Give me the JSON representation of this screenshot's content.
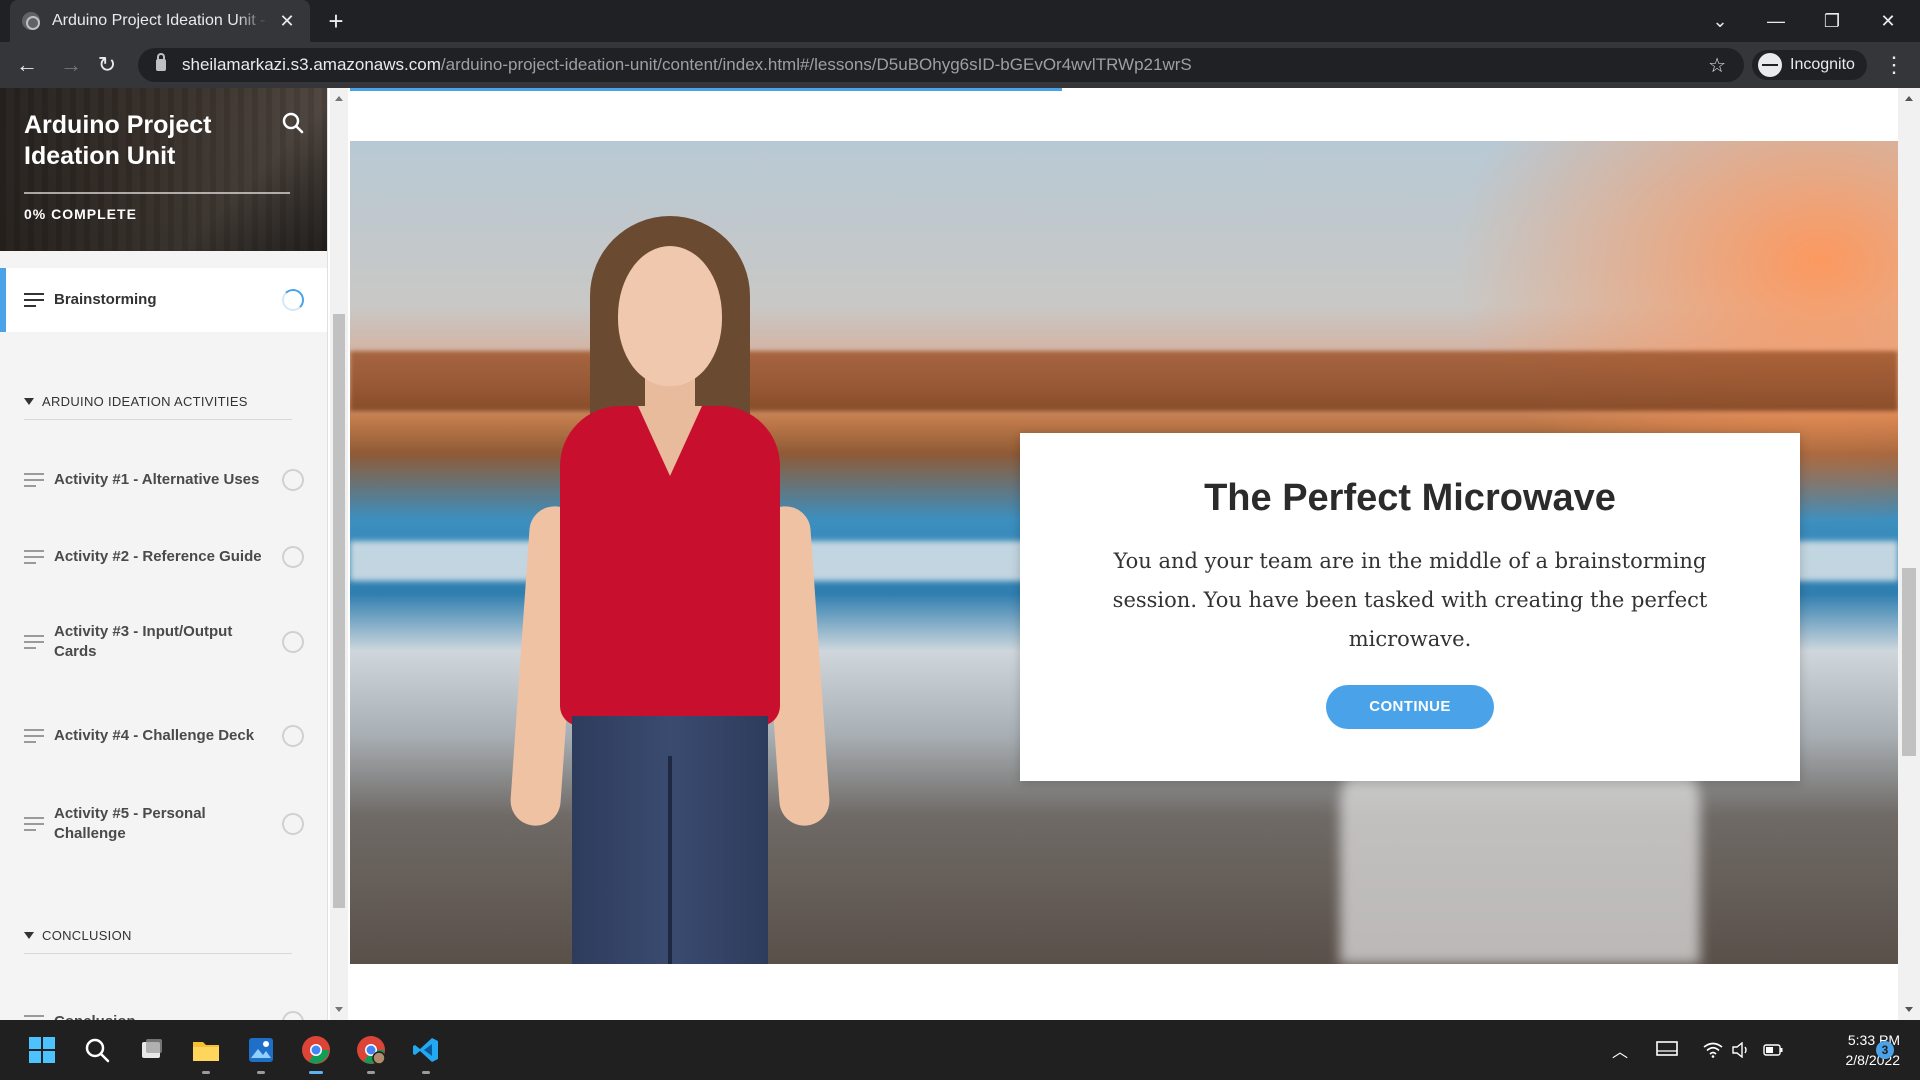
{
  "browser": {
    "tab_title": "Arduino Project Ideation Unit - B",
    "url_host": "sheilamarkazi.s3.amazonaws.com",
    "url_path": "/arduino-project-ideation-unit/content/index.html#/lessons/D5uBOhyg6sID-bGEvOr4wvlTRWp21wrS",
    "profile_label": "Incognito"
  },
  "sidebar": {
    "course_title": "Arduino Project Ideation Unit",
    "progress_label": "0% COMPLETE",
    "current_lesson": "Brainstorming",
    "sections": [
      {
        "title": "ARDUINO IDEATION ACTIVITIES",
        "lessons": [
          "Activity #1 - Alternative Uses",
          "Activity #2 - Reference Guide",
          "Activity #3 - Input/Output Cards",
          "Activity #4 - Challenge Deck",
          "Activity #5 - Personal Challenge"
        ]
      },
      {
        "title": "CONCLUSION",
        "lessons": [
          "Conclusion"
        ]
      }
    ]
  },
  "content": {
    "reading_progress": 0.46,
    "card_title": "The Perfect Microwave",
    "card_body": "You and your team are in the middle of a brainstorming session. You have been tasked with creating the perfect microwave.",
    "continue_label": "CONTINUE"
  },
  "taskbar": {
    "time": "5:33 PM",
    "date": "2/8/2022",
    "notification_count": "3"
  },
  "colors": {
    "accent": "#4aa3e8",
    "chrome_dark": "#202124",
    "chrome_mid": "#35363a"
  }
}
